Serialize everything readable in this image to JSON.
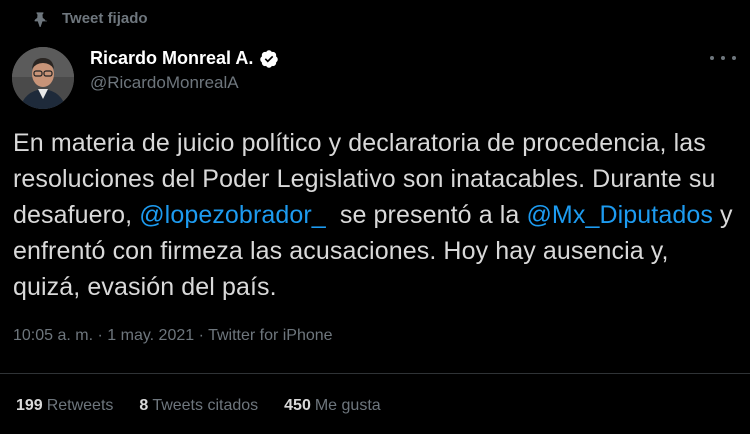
{
  "pinned_label": "Tweet fijado",
  "author": {
    "name": "Ricardo Monreal A.",
    "handle": "@RicardoMonrealA",
    "verified": true
  },
  "tweet": {
    "segments": [
      {
        "text": "En materia de juicio político y declaratoria de procedencia, las resoluciones del Poder Legislativo son inatacables. Durante su desafuero, ",
        "mention": false
      },
      {
        "text": "@lopezobrador_",
        "mention": true
      },
      {
        "text": "  se presentó a la ",
        "mention": false
      },
      {
        "text": "@Mx_Diputados",
        "mention": true
      },
      {
        "text": " y enfrentó con firmeza las acusaciones. Hoy hay ausencia y, quizá, evasión del país.",
        "mention": false
      }
    ]
  },
  "meta": "10:05 a. m. · 1 may. 2021 · Twitter for iPhone",
  "stats": {
    "retweets_count": "199",
    "retweets_label": "Retweets",
    "quotes_count": "8",
    "quotes_label": "Tweets citados",
    "likes_count": "450",
    "likes_label": "Me gusta"
  },
  "colors": {
    "background": "#000000",
    "text": "#d9d9d9",
    "secondary": "#6e767d",
    "link": "#1d9bf0",
    "divider": "#2f3336"
  },
  "icons": {
    "pinned": "pin-icon",
    "verified": "verified-badge-icon",
    "more": "more-options-icon"
  }
}
